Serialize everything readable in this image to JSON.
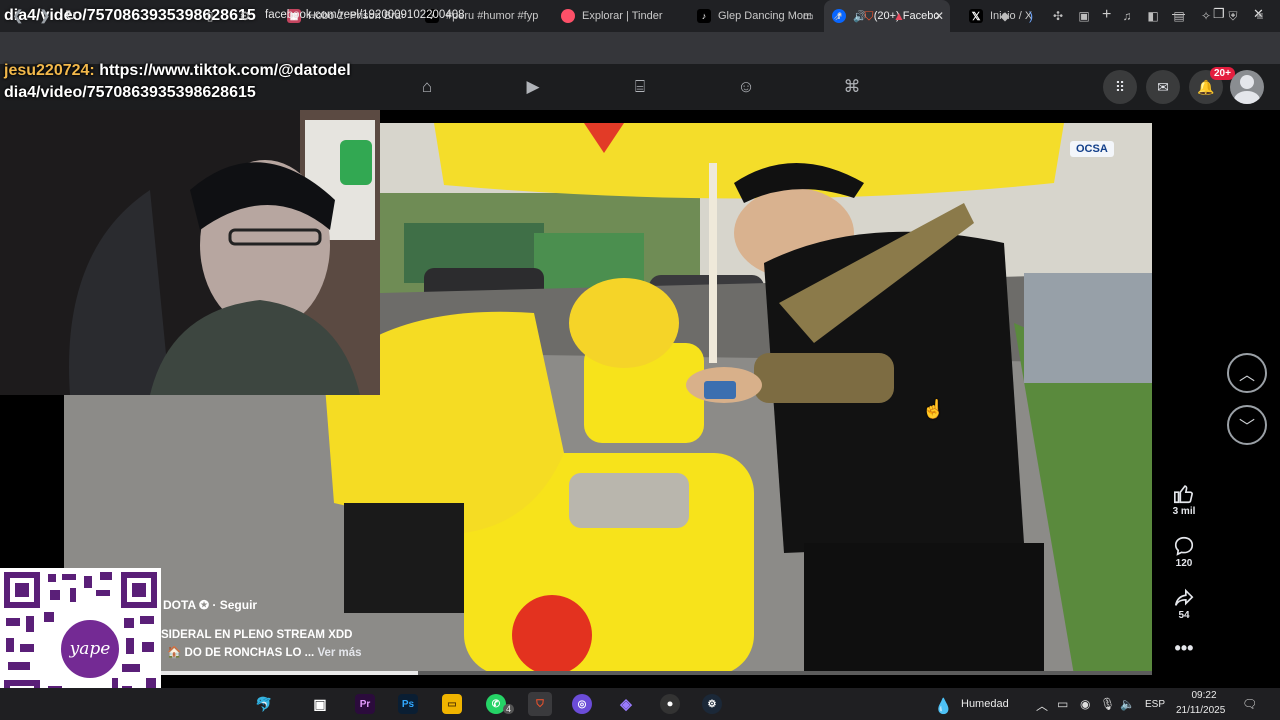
{
  "tabs": [
    {
      "label": "dia4/video/757086393539862 8615",
      "icon": "tiktok-overlay"
    },
    {
      "label": "Hobo 2: Prison Brav",
      "icon": "game-icon"
    },
    {
      "label": "#peru #humor #fyp",
      "icon": "tiktok-icon"
    },
    {
      "label": "Explorar | Tinder",
      "icon": "tinder-icon"
    },
    {
      "label": "Glep Dancing Mom",
      "icon": "tiktok-icon"
    },
    {
      "label": "(20+) Facebo",
      "icon": "facebook-icon"
    },
    {
      "label": "Inicio / X",
      "icon": "x-icon"
    }
  ],
  "address": {
    "url": "facebook.com/reel/1920009102200408"
  },
  "chat": {
    "user": "jesu220724:",
    "message_line1": "https://www.tiktok.com/@datodel",
    "message_line2": "dia4/video/7570863935398628615"
  },
  "facebook": {
    "notification_badge": "20+",
    "reel": {
      "author": "DOTA",
      "follow_label": "· Seguir",
      "caption_line1": "SIDERAL EN PLENO STREAM XDD",
      "caption_line2": "DO DE RONCHAS LO ...",
      "see_more": "Ver más",
      "progress": 0.26,
      "likes": "3 mil",
      "comments": "120",
      "shares": "54"
    },
    "sponsor_badge": "OCSA"
  },
  "overlay": {
    "qr_brand": "yape"
  },
  "taskbar": {
    "weather": "Humedad",
    "language": "ESP",
    "time": "09:22",
    "date": "21/11/2025",
    "whatsapp_badge": "4",
    "notification_count": "4"
  },
  "colors": {
    "accent": "#0866ff",
    "tab_bar": "#202124",
    "chat_user": "#f2b84b",
    "yellow": "#f7e31b"
  }
}
